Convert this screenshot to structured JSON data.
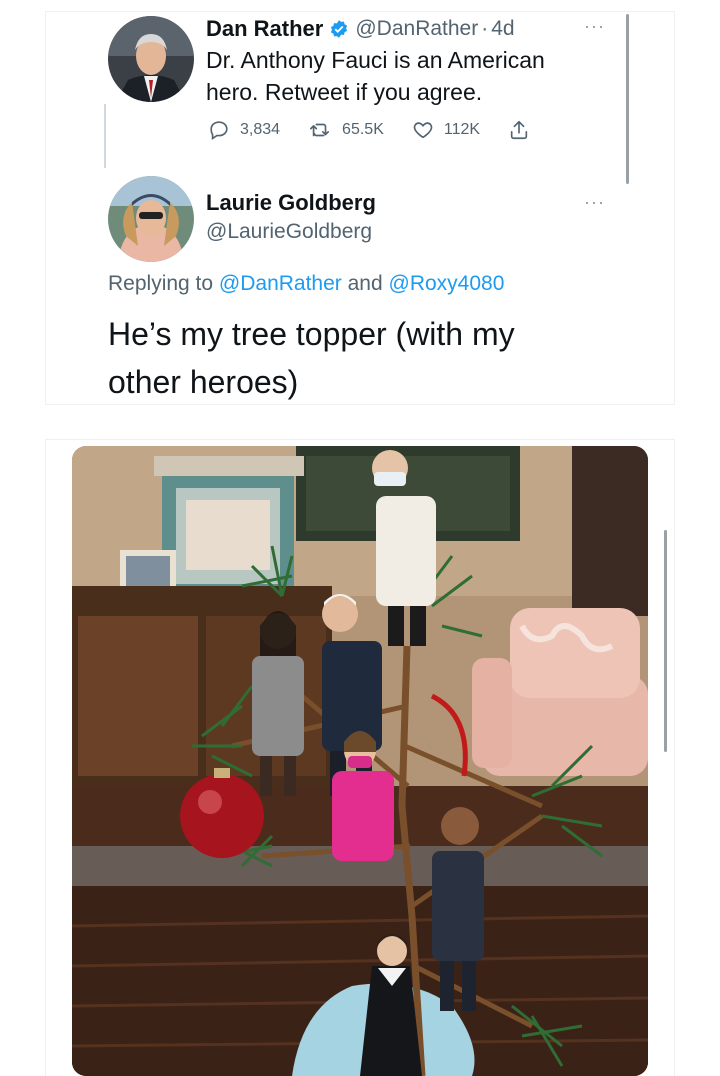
{
  "original_tweet": {
    "author_name": "Dan Rather",
    "verified": true,
    "handle": "@DanRather",
    "separator": "·",
    "time": "4d",
    "text_line1": "Dr. Anthony Fauci is an American",
    "text_line2": "hero. Retweet if you agree.",
    "replies": "3,834",
    "retweets": "65.5K",
    "likes": "112K"
  },
  "reply_tweet": {
    "author_name": "Laurie Goldberg",
    "handle": "@LaurieGoldberg",
    "replying_prefix": "Replying to",
    "mention1": "@DanRather",
    "conjunction": "and",
    "mention2": "@Roxy4080",
    "text_line1": "He’s my tree topper (with my",
    "text_line2": "other heroes)"
  },
  "more_glyph": "···",
  "colors": {
    "accent_blue": "#1d9bf0",
    "text_primary": "#0f1419",
    "text_secondary": "#536471"
  },
  "icons": [
    "verified-badge-icon",
    "reply-icon",
    "retweet-icon",
    "like-icon",
    "share-icon",
    "more-icon"
  ]
}
